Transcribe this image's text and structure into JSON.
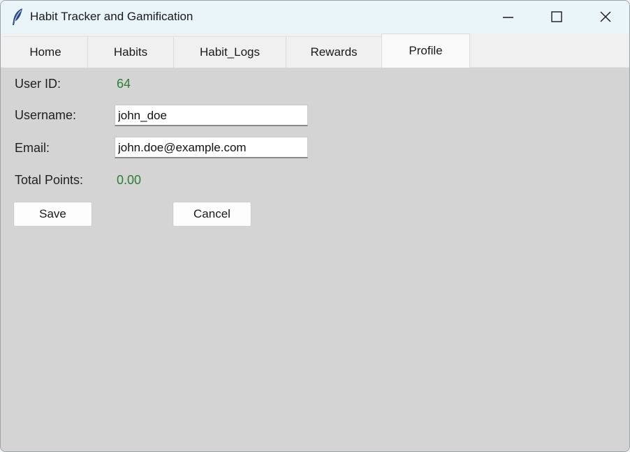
{
  "window": {
    "title": "Habit Tracker and Gamification",
    "icon": "feather-icon",
    "controls": [
      "minimize-icon",
      "maximize-icon",
      "close-icon"
    ]
  },
  "tabs": [
    {
      "label": "Home",
      "active": false
    },
    {
      "label": "Habits",
      "active": false
    },
    {
      "label": "Habit_Logs",
      "active": false
    },
    {
      "label": "Rewards",
      "active": false
    },
    {
      "label": "Profile",
      "active": true
    }
  ],
  "profile": {
    "user_id_label": "User ID:",
    "user_id_value": "64",
    "username_label": "Username:",
    "username_value": "john_doe",
    "email_label": "Email:",
    "email_value": "john.doe@example.com",
    "points_label": "Total Points:",
    "points_value": "0.00",
    "save_label": "Save",
    "cancel_label": "Cancel"
  },
  "colors": {
    "titlebar": "#e9f5f8",
    "content_bg": "#d4d4d4",
    "value_green": "#2f7d32"
  }
}
